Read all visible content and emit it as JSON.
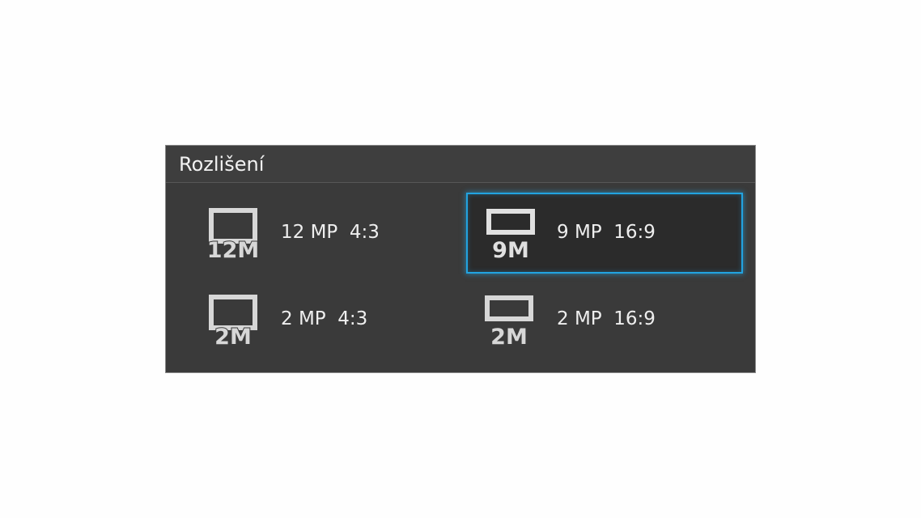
{
  "dialog": {
    "title": "Rozlišení",
    "options": [
      {
        "label": "12 MP  4:3",
        "icon_text": "12M",
        "icon": "resolution-4-3-icon",
        "selected": false
      },
      {
        "label": "9 MP  16:9",
        "icon_text": "9M",
        "icon": "resolution-16-9-icon",
        "selected": true
      },
      {
        "label": "2 MP  4:3",
        "icon_text": "2M",
        "icon": "resolution-4-3-icon",
        "selected": false
      },
      {
        "label": "2 MP  16:9",
        "icon_text": "2M",
        "icon": "resolution-16-9-icon",
        "selected": false
      }
    ]
  },
  "colors": {
    "dialog_bg": "#3a3a3a",
    "selection_border": "#22a3e0",
    "text": "#eeeeee"
  }
}
